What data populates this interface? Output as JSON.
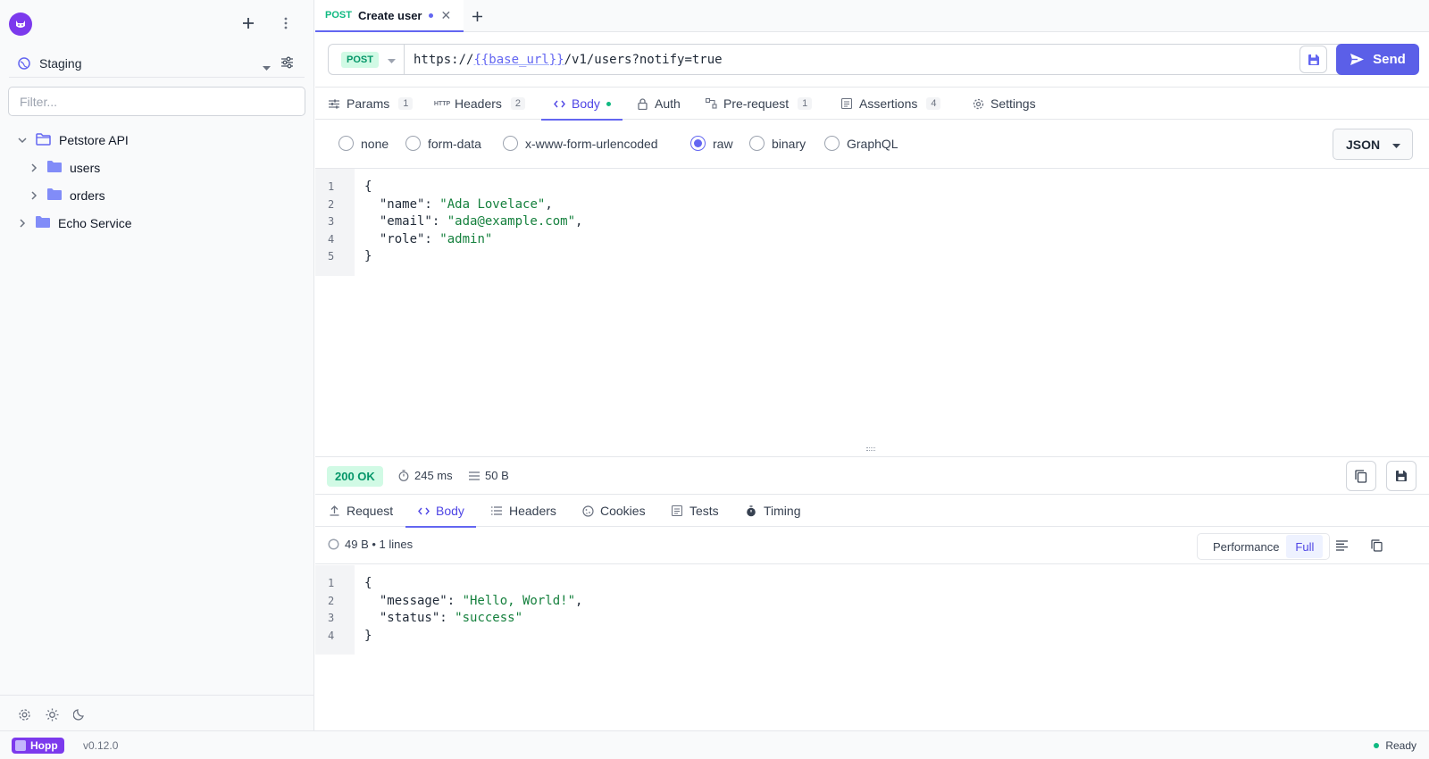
{
  "sidebar": {
    "environment": "Staging",
    "filter_placeholder": "Filter...",
    "tree": [
      {
        "name": "Petstore API",
        "level": 0,
        "expanded": true
      },
      {
        "name": "users",
        "level": 1,
        "expanded": false
      },
      {
        "name": "orders",
        "level": 1,
        "expanded": false
      },
      {
        "name": "Echo Service",
        "level": 0,
        "expanded": false
      }
    ]
  },
  "tab": {
    "method": "POST",
    "title": "Create user"
  },
  "request": {
    "method": "POST",
    "url_prefix": "https://",
    "url_var": "{{base_url}}",
    "url_suffix": "/v1/users?notify=true",
    "send_label": "Send"
  },
  "request_tabs": [
    {
      "label": "Params",
      "count": "1"
    },
    {
      "label": "Headers",
      "count": "2"
    },
    {
      "label": "Body",
      "active": true
    },
    {
      "label": "Auth"
    },
    {
      "label": "Pre-request",
      "count": "1"
    },
    {
      "label": "Assertions",
      "count": "4"
    },
    {
      "label": "Settings"
    }
  ],
  "body_types": [
    "none",
    "form-data",
    "x-www-form-urlencoded",
    "raw",
    "binary",
    "GraphQL"
  ],
  "body_type_selected": "raw",
  "content_type": "JSON",
  "request_body": {
    "line_numbers": [
      "1",
      "2",
      "3",
      "4",
      "5"
    ],
    "lines": [
      [
        {
          "t": "{"
        }
      ],
      [
        {
          "t": "  \"name\": "
        },
        {
          "t": "\"Ada Lovelace\"",
          "s": 1
        },
        {
          "t": ","
        }
      ],
      [
        {
          "t": "  \"email\": "
        },
        {
          "t": "\"ada@example.com\"",
          "s": 1
        },
        {
          "t": ","
        }
      ],
      [
        {
          "t": "  \"role\": "
        },
        {
          "t": "\"admin\"",
          "s": 1
        }
      ],
      [
        {
          "t": "}"
        }
      ]
    ]
  },
  "response": {
    "status": "200 OK",
    "time": "245 ms",
    "size": "50 B",
    "tabs": [
      "Request",
      "Body",
      "Headers",
      "Cookies",
      "Tests",
      "Timing"
    ],
    "active_tab": "Body",
    "info": "49 B • 1 lines",
    "view_modes": [
      "Performance",
      "Full"
    ],
    "view_mode_selected": "Full",
    "line_numbers": [
      "1",
      "2",
      "3",
      "4"
    ],
    "lines": [
      [
        {
          "t": "{"
        }
      ],
      [
        {
          "t": "  \"message\": "
        },
        {
          "t": "\"Hello, World!\"",
          "s": 1
        },
        {
          "t": ","
        }
      ],
      [
        {
          "t": "  \"status\": "
        },
        {
          "t": "\"success\"",
          "s": 1
        }
      ],
      [
        {
          "t": "}"
        }
      ]
    ]
  },
  "statusbar": {
    "brand": "Hopp",
    "version": "v0.12.0",
    "status": "Ready"
  },
  "colors": {
    "accent": "#6366f1",
    "success": "#10b981",
    "brand": "#7c3aed"
  }
}
